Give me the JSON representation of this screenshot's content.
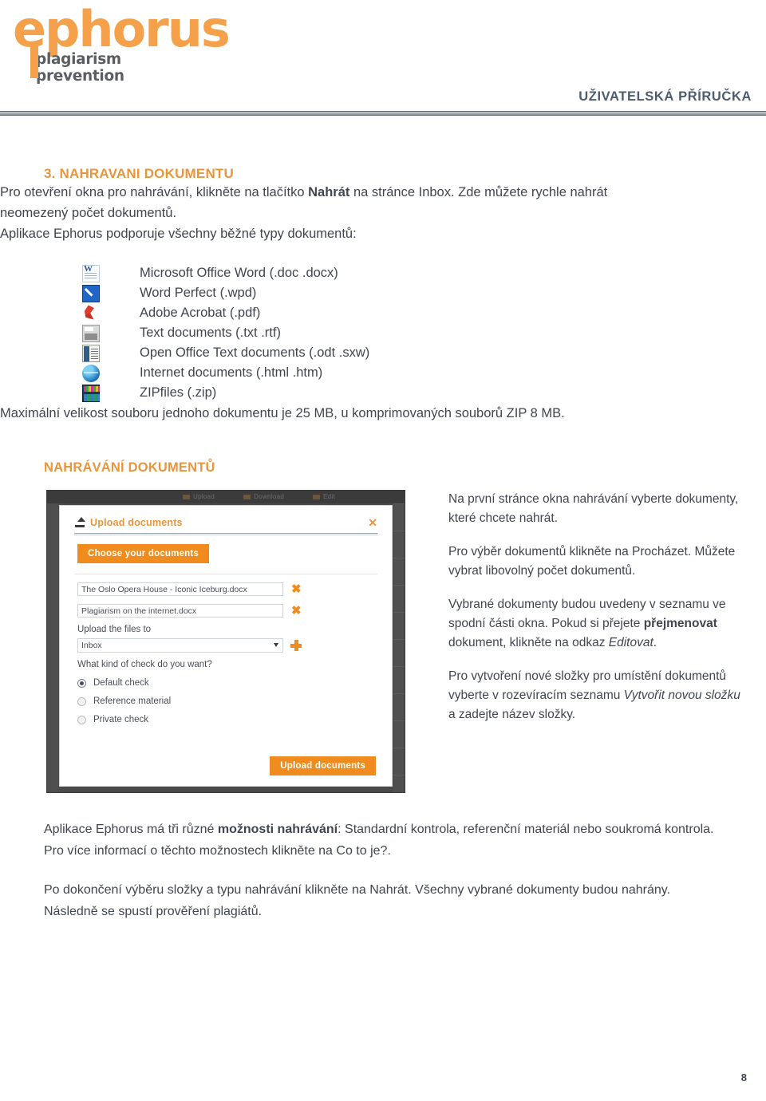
{
  "header": {
    "logo_word": "ephorus",
    "logo_tagline": "plagiarism prevention",
    "manual_title": "UŽIVATELSKÁ PŘÍRUČKA",
    "accent_orange": "#F5A04A",
    "title_color": "#4c5c6e"
  },
  "section": {
    "heading": "3. NAHRAVANI DOKUMENTU",
    "intro_before_bold": "Pro otevření okna pro nahrávání, klikněte na tlačítko ",
    "intro_bold": "Nahrát",
    "intro_after_bold": " na stránce Inbox. Zde můžete rychle nahrát neomezený počet dokumentů.",
    "supports_line": "Aplikace Ephorus podporuje všechny běžné typy dokumentů:",
    "max_size_line": "Maximální velikost souboru jednoho dokumentu je 25 MB, u komprimovaných souborů ZIP 8 MB.",
    "sub_heading": "NAHRÁVÁNÍ DOKUMENTŮ"
  },
  "filetypes": [
    {
      "icon": "word-icon",
      "label": "Microsoft Office Word (.doc .docx)"
    },
    {
      "icon": "wordperfect-icon",
      "label": "Word Perfect (.wpd)"
    },
    {
      "icon": "acrobat-icon",
      "label": "Adobe Acrobat (.pdf)"
    },
    {
      "icon": "text-document-icon",
      "label": "Text documents (.txt .rtf)"
    },
    {
      "icon": "openoffice-icon",
      "label": "Open Office Text documents (.odt .sxw)"
    },
    {
      "icon": "globe-icon",
      "label": "Internet documents (.html .htm)"
    },
    {
      "icon": "zip-icon",
      "label": "ZIPfiles (.zip)"
    }
  ],
  "screenshot": {
    "faded_menu": [
      "Upload",
      "Download",
      "Edit"
    ],
    "dialog": {
      "title": "Upload documents",
      "close_label": "✕",
      "choose_button": "Choose your documents",
      "files": [
        {
          "name": "The Oslo Opera House - Iconic Iceburg.docx",
          "remove": "✖"
        },
        {
          "name": "Plagiarism on the internet.docx",
          "remove": "✖"
        }
      ],
      "upload_to_label": "Upload the files to",
      "folder_selected": "Inbox",
      "check_question": "What kind of check do you want?",
      "check_options": [
        {
          "label": "Default check",
          "selected": true
        },
        {
          "label": "Reference material",
          "selected": false
        },
        {
          "label": "Private check",
          "selected": false
        }
      ],
      "submit_button": "Upload documents"
    }
  },
  "side_text": {
    "p1": "Na první stránce okna nahrávání vyberte dokumenty, které chcete nahrát.",
    "p2": "Pro výběr dokumentů klikněte na Procházet. Můžete vybrat libovolný počet dokumentů.",
    "p3_a": "Vybrané dokumenty budou uvedeny v seznamu ve spodní části okna. Pokud si přejete ",
    "p3_bold": "přejmenovat",
    "p3_b": " dokument, klikněte na odkaz ",
    "p3_italic": "Editovat",
    "p3_c": ".",
    "p4_a": "Pro vytvoření nové složky pro umístění dokumentů vyberte v rozevíracím seznamu ",
    "p4_italic": "Vytvořit novou složku",
    "p4_b": " a zadejte název složky."
  },
  "tail": {
    "p1_a": "Aplikace Ephorus má tři různé ",
    "p1_bold": "možnosti nahrávání",
    "p1_b": ": Standardní kontrola, referenční materiál nebo soukromá kontrola. Pro více informací o těchto možnostech klikněte na Co to je?.",
    "p2": "Po dokončení výběru složky a typu nahrávání klikněte na Nahrát. Všechny vybrané dokumenty budou nahrány. Následně se spustí prověření plagiátů."
  },
  "page_number": "8"
}
